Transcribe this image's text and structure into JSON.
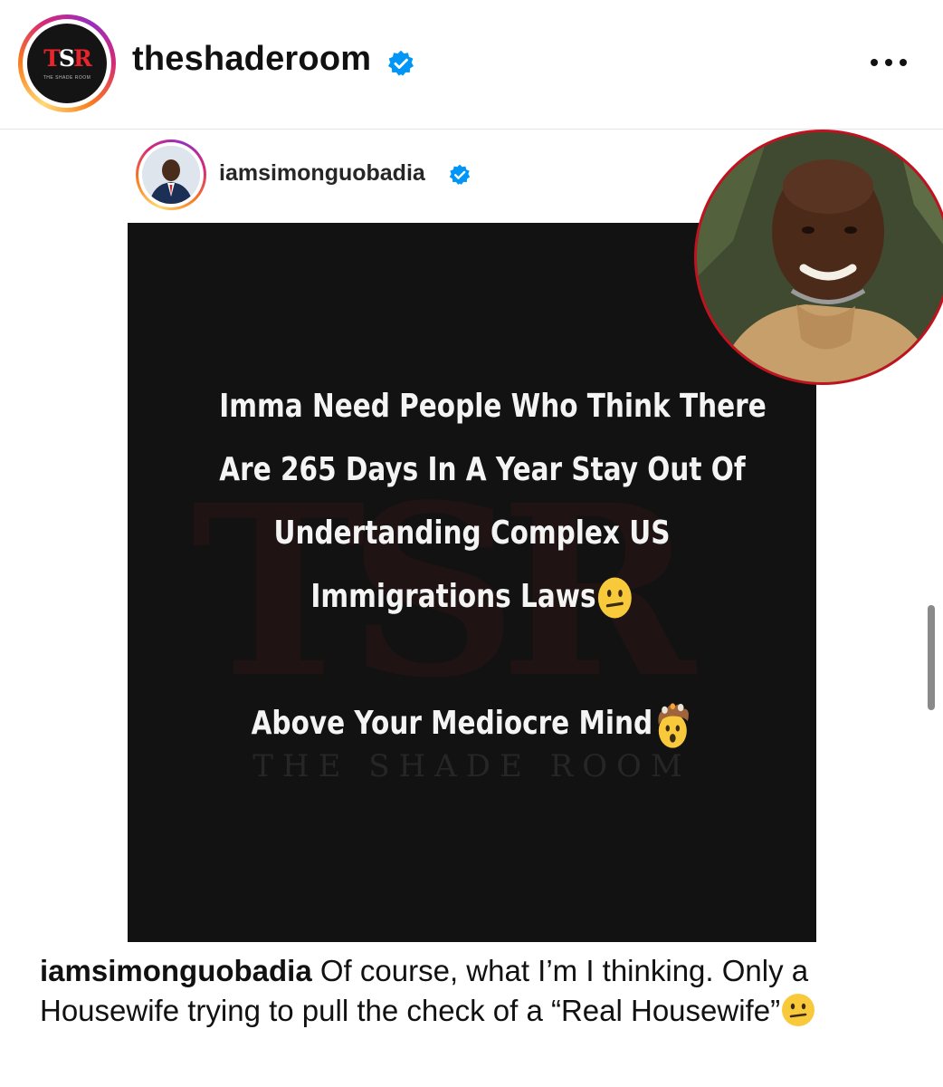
{
  "header": {
    "username": "theshaderoom",
    "verified": true,
    "avatar_logo": {
      "letters_left": "T",
      "letters_mid": "S",
      "letters_right": "R",
      "subtitle": "THE SHADE ROOM"
    },
    "more_icon": "ellipsis-icon"
  },
  "repost": {
    "username": "iamsimonguobadia",
    "verified": true
  },
  "quote_card": {
    "lines": [
      "Imma Need People Who Think There",
      "Are 265 Days In A Year Stay Out Of",
      "Undertanding Complex US",
      "Immigrations Laws"
    ],
    "line4_emoji": "neutral-face-emoji",
    "second_line": "Above Your Mediocre Mind",
    "second_emoji": "exploding-head-emoji",
    "watermark_logo": "TSR",
    "watermark_text": "THE SHADE ROOM"
  },
  "overlay": {
    "description_icon": "person-photo"
  },
  "caption": {
    "username": "iamsimonguobadia",
    "text": "Of course, what I’m I thinking. Only a Housewife trying to pull the check of a “Real Housewife”",
    "emoji": "neutral-face-emoji"
  },
  "colors": {
    "verified_blue": "#0095f6",
    "card_background": "#121212",
    "overlay_border": "#c1121f",
    "brand_red": "#e8252c"
  }
}
